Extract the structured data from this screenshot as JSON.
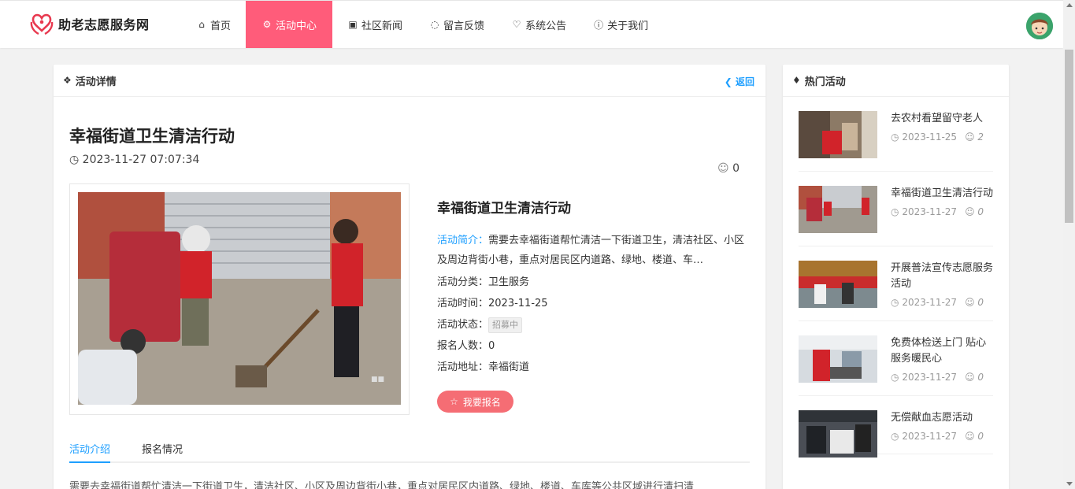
{
  "header": {
    "site_name": "助老志愿服务网",
    "nav": [
      {
        "label": "首页",
        "icon": "home-icon",
        "active": false
      },
      {
        "label": "活动中心",
        "icon": "gear-icon",
        "active": true
      },
      {
        "label": "社区新闻",
        "icon": "news-icon",
        "active": false
      },
      {
        "label": "留言反馈",
        "icon": "chat-icon",
        "active": false
      },
      {
        "label": "系统公告",
        "icon": "bell-icon",
        "active": false
      },
      {
        "label": "关于我们",
        "icon": "info-icon",
        "active": false
      }
    ]
  },
  "detail": {
    "card_title": "活动详情",
    "back_label": "返回",
    "title": "幸福街道卫生清洁行动",
    "datetime": "2023-11-27 07:07:34",
    "likes": "0",
    "info_title": "幸福街道卫生清洁行动",
    "intro_label": "活动简介：",
    "intro_text": "需要去幸福街道帮忙清洁一下街道卫生，清洁社区、小区及周边背街小巷，重点对居民区内道路、绿地、楼道、车…",
    "category_label": "活动分类：",
    "category": "卫生服务",
    "time_label": "活动时间：",
    "time": "2023-11-25",
    "status_label": "活动状态：",
    "status": "招募中",
    "count_label": "报名人数：",
    "count": "0",
    "address_label": "活动地址：",
    "address": "幸福街道",
    "signup_label": "我要报名",
    "tabs": [
      "活动介绍",
      "报名情况"
    ],
    "description": "需要去幸福街道帮忙清洁一下街道卫生，清洁社区、小区及周边背街小巷，重点对居民区内道路、绿地、楼道、车库等公共区域进行清扫清"
  },
  "hot": {
    "title": "热门活动",
    "items": [
      {
        "title": "去农村看望留守老人",
        "date": "2023-11-25",
        "count": "2"
      },
      {
        "title": "幸福街道卫生清洁行动",
        "date": "2023-11-27",
        "count": "0"
      },
      {
        "title": "开展普法宣传志愿服务活动",
        "date": "2023-11-27",
        "count": "0"
      },
      {
        "title": "免费体检送上门 贴心服务暖民心",
        "date": "2023-11-27",
        "count": "0"
      },
      {
        "title": "无偿献血志愿活动",
        "date": "2023-11-27",
        "count": "0"
      }
    ]
  },
  "colors": {
    "accent": "#ff5c7a",
    "link": "#1e9fff",
    "button": "#f56d74"
  }
}
